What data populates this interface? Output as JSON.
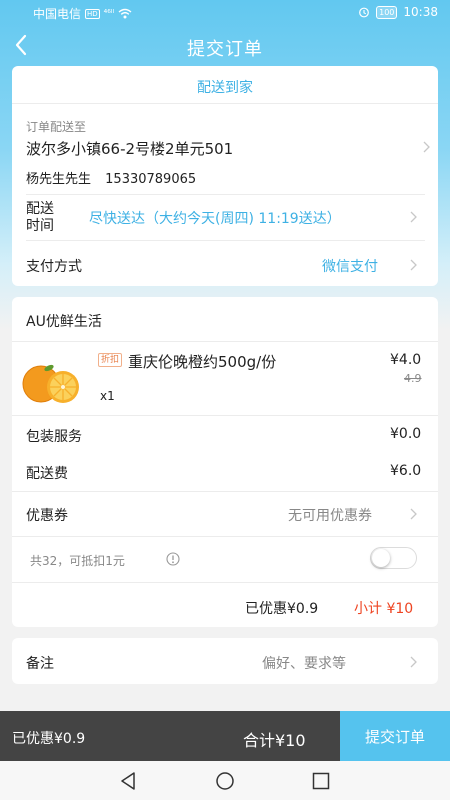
{
  "status_bar": {
    "carrier": "中国电信",
    "hd": "HD",
    "signal": "⁴⁶ᴵᴵ",
    "battery": "100",
    "time": "10:38"
  },
  "header": {
    "title": "提交订单"
  },
  "delivery": {
    "mode": "配送到家",
    "address_label": "订单配送至",
    "address": "波尔多小镇66-2号楼2单元501",
    "contact_name": "杨先生先生",
    "contact_phone": "15330789065",
    "time_label_line1": "配送",
    "time_label_line2": "时间",
    "time_value": "尽快送达（大约今天(周四) 11:19送达）",
    "payment_label": "支付方式",
    "payment_value": "微信支付"
  },
  "store": {
    "name": "AU优鲜生活",
    "product": {
      "tag": "折扣",
      "name": "重庆伦晚橙约500g/份",
      "price": "¥4.0",
      "original_price": "4.9",
      "quantity": "x1"
    },
    "packing_label": "包装服务",
    "packing_value": "¥0.0",
    "delivery_fee_label": "配送费",
    "delivery_fee_value": "¥6.0",
    "coupon_label": "优惠券",
    "coupon_value": "无可用优惠券",
    "points_text": "共32，可抵扣1元",
    "points_toggle_on": false,
    "discount_text": "已优惠¥0.9",
    "subtotal_text": "小计 ¥10"
  },
  "remark": {
    "label": "备注",
    "placeholder": "偏好、要求等"
  },
  "footer": {
    "discount": "已优惠¥0.9",
    "total": "合计¥10",
    "submit_label": "提交订单"
  },
  "colors": {
    "accent": "#3eb1e4",
    "submit": "#55c3ee",
    "price_red": "#ee4422",
    "footer_bg": "#444444"
  }
}
